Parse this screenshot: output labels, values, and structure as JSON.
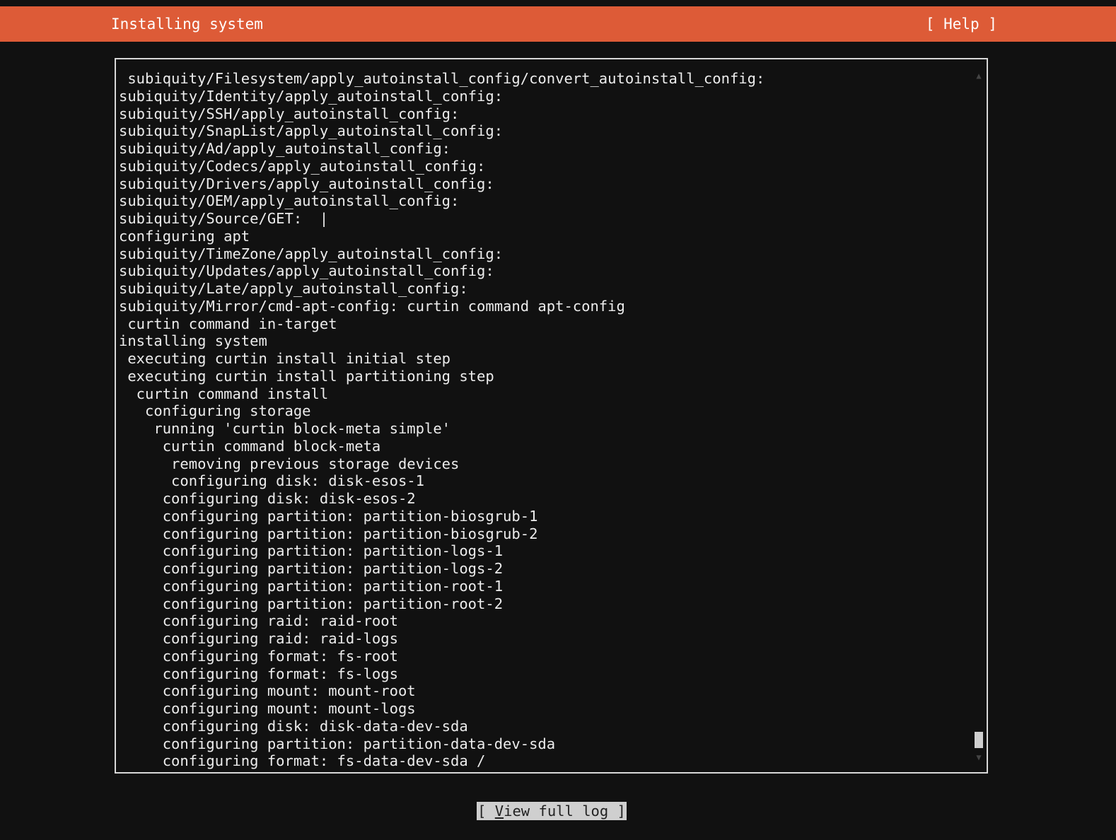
{
  "header": {
    "title": "Installing system",
    "help_label": "[ Help ]"
  },
  "log": {
    "lines": [
      " subiquity/Filesystem/apply_autoinstall_config/convert_autoinstall_config:",
      "subiquity/Identity/apply_autoinstall_config:",
      "subiquity/SSH/apply_autoinstall_config:",
      "subiquity/SnapList/apply_autoinstall_config:",
      "subiquity/Ad/apply_autoinstall_config:",
      "subiquity/Codecs/apply_autoinstall_config:",
      "subiquity/Drivers/apply_autoinstall_config:",
      "subiquity/OEM/apply_autoinstall_config:",
      "subiquity/Source/GET:  |",
      "configuring apt",
      "subiquity/TimeZone/apply_autoinstall_config:",
      "subiquity/Updates/apply_autoinstall_config:",
      "subiquity/Late/apply_autoinstall_config:",
      "subiquity/Mirror/cmd-apt-config: curtin command apt-config",
      " curtin command in-target",
      "installing system",
      " executing curtin install initial step",
      " executing curtin install partitioning step",
      "  curtin command install",
      "   configuring storage",
      "    running 'curtin block-meta simple'",
      "     curtin command block-meta",
      "      removing previous storage devices",
      "      configuring disk: disk-esos-1",
      "     configuring disk: disk-esos-2",
      "     configuring partition: partition-biosgrub-1",
      "     configuring partition: partition-biosgrub-2",
      "     configuring partition: partition-logs-1",
      "     configuring partition: partition-logs-2",
      "     configuring partition: partition-root-1",
      "     configuring partition: partition-root-2",
      "     configuring raid: raid-root",
      "     configuring raid: raid-logs",
      "     configuring format: fs-root",
      "     configuring format: fs-logs",
      "     configuring mount: mount-root",
      "     configuring mount: mount-logs",
      "     configuring disk: disk-data-dev-sda",
      "     configuring partition: partition-data-dev-sda",
      "     configuring format: fs-data-dev-sda /"
    ],
    "scroll_up_icon": "▲",
    "scroll_down_icon": "▼"
  },
  "footer": {
    "view_log_prefix": "[ ",
    "view_log_hotkey": "V",
    "view_log_rest": "iew full log ]"
  },
  "colors": {
    "header_bg": "#dd5b37",
    "background": "#111111",
    "button_bg": "#cfcfcf"
  }
}
